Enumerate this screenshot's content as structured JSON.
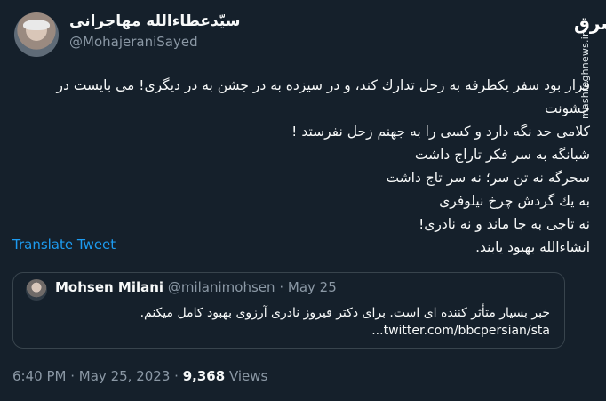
{
  "header": {
    "display_name": "سیّدعطاءالله مهاجرانی",
    "handle": "@MohajeraniSayed"
  },
  "brand": {
    "logo_text": "مشرق",
    "vertical_text": "mashreghnews.ir"
  },
  "tweet": {
    "lines": [
      "قرار بود سفر یکطرفه به  زحل تدارك کند، و در سیزده به در جشن به در دیگری! می بایست در خشونت",
      "کلامی حد نگه دارد و کسی را به جهنم زحل نفرستد !",
      "شبانگه به سر فکر تاراج داشت",
      "سحرگه نه تن سر؛ نه سر تاج داشت",
      "به یك گردش چرخ نیلوفری",
      "نه تاجی به جا ماند و نه نادری!",
      "انشاءالله بهبود یابند."
    ],
    "translate_label": "Translate Tweet"
  },
  "quote": {
    "author_name": "Mohsen Milani",
    "author_handle": "@milanimohsen",
    "separator": "·",
    "date": "May 25",
    "body_line1": "خبر بسیار متأثر کننده ای است. برای دکتر فیروز نادری آرزوی بهبود کامل میکنم.",
    "body_link": "twitter.com/bbcpersian/sta..."
  },
  "footer": {
    "time": "6:40 PM",
    "sep1": "·",
    "date": "May 25, 2023",
    "sep2": "·",
    "views_count": "9,368",
    "views_label": "Views"
  }
}
